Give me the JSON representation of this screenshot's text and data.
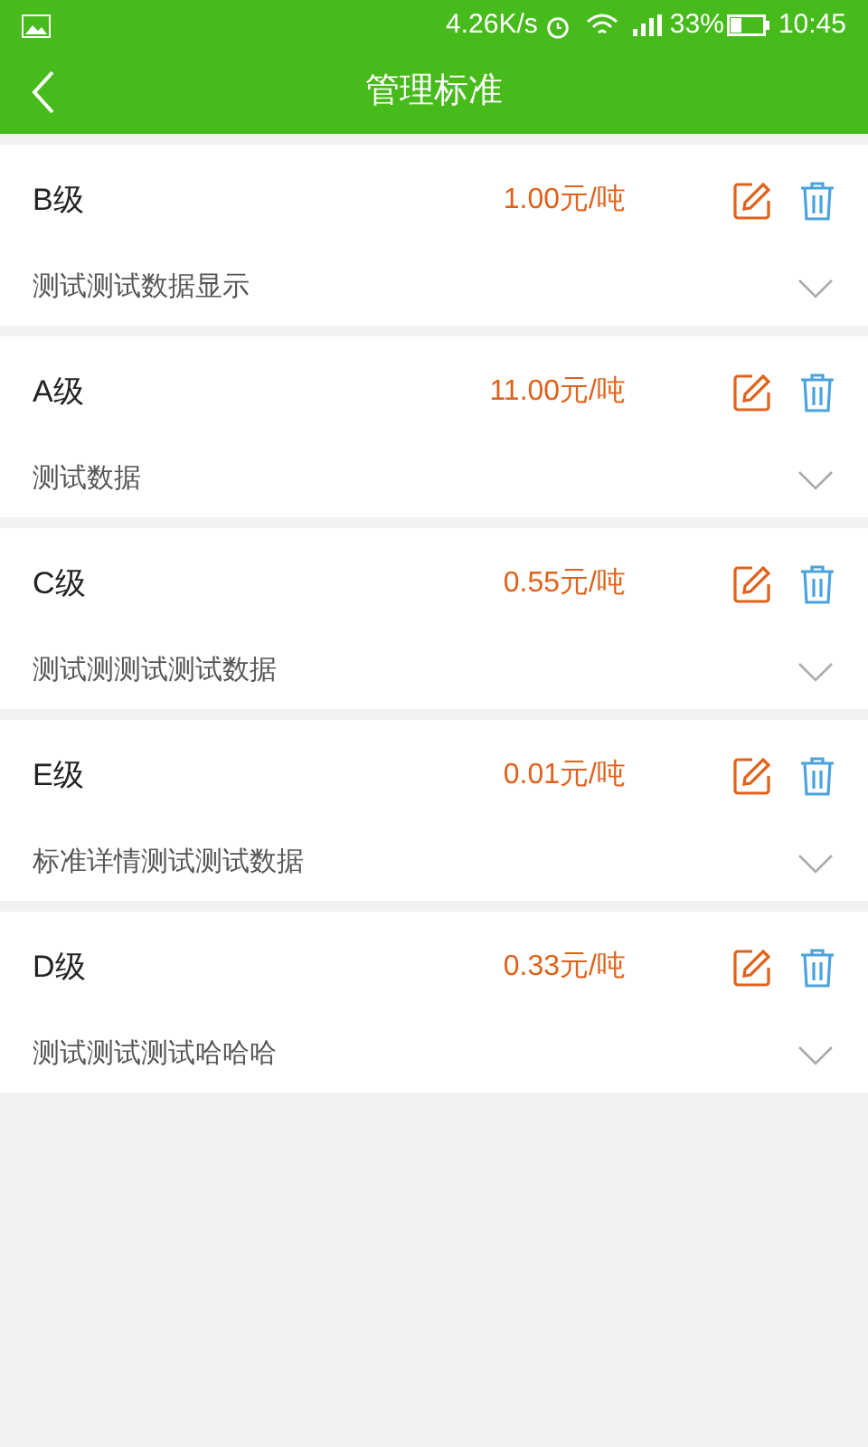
{
  "status_bar": {
    "speed": "4.26K/s",
    "battery": "33%",
    "time": "10:45"
  },
  "header": {
    "title": "管理标准"
  },
  "standards": [
    {
      "name": "B级",
      "price": "1.00元/吨",
      "description": "测试测试数据显示",
      "expanded": false
    },
    {
      "name": "A级",
      "price": "11.00元/吨",
      "description": "测试数据",
      "expanded": false
    },
    {
      "name": "C级",
      "price": "0.55元/吨",
      "description": "测试测测试测试数据",
      "expanded": false
    },
    {
      "name": "E级",
      "price": "0.01元/吨",
      "description": "标准详情测试测试数据",
      "expanded": false
    },
    {
      "name": "D级",
      "price": "0.33元/吨",
      "description": "测试测试测试哈哈哈",
      "expanded": false
    }
  ]
}
